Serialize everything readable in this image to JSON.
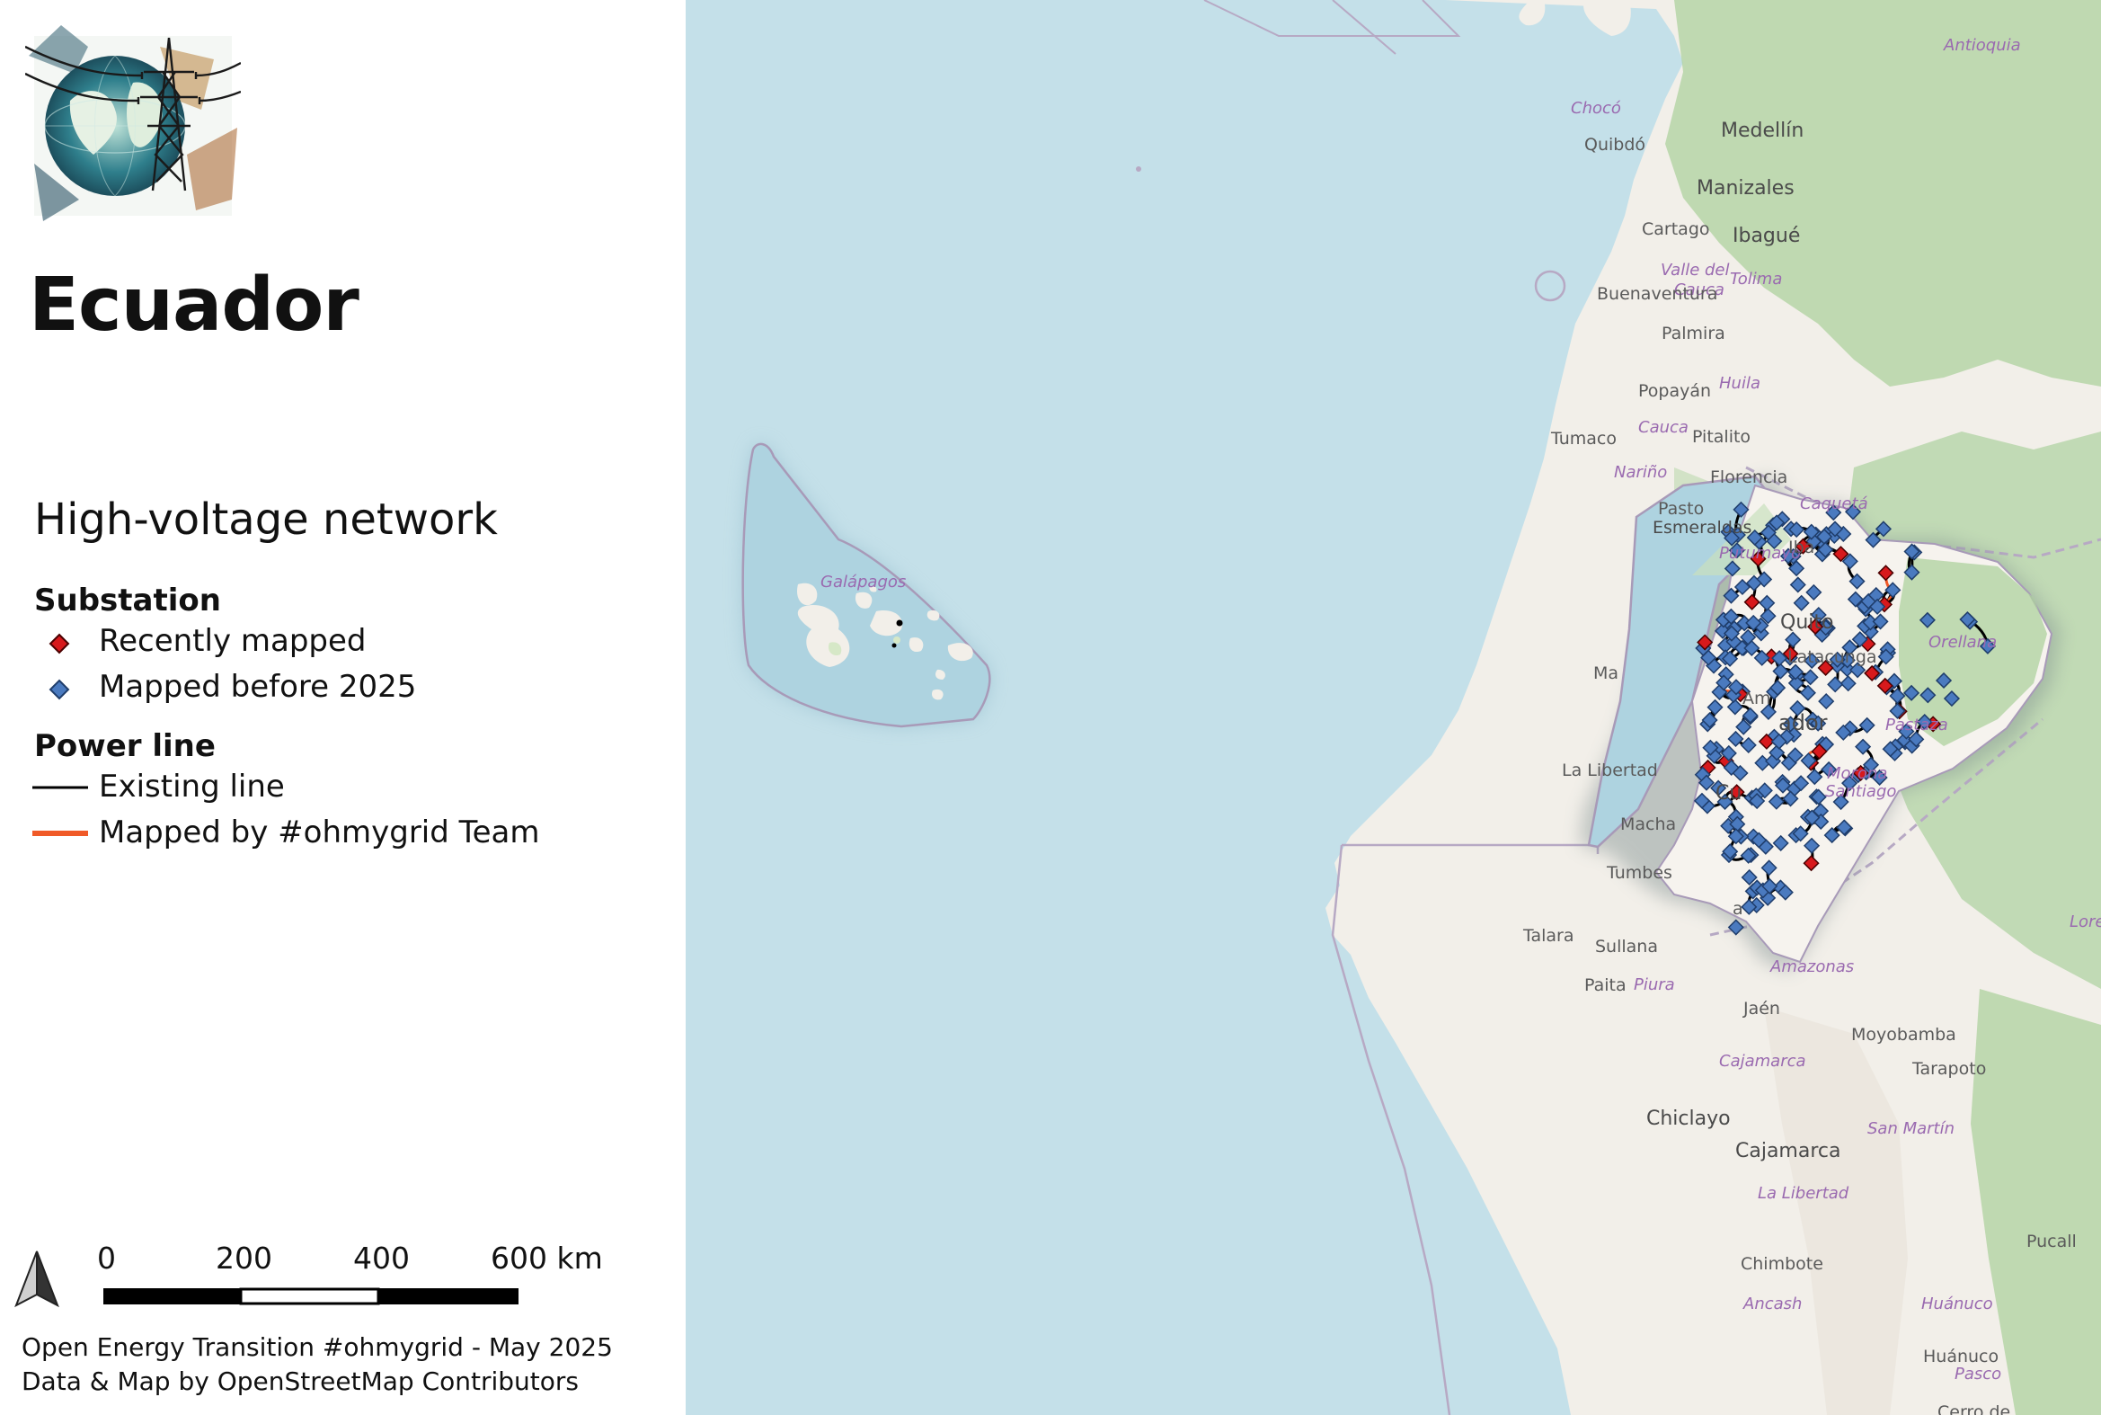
{
  "title": "Ecuador",
  "legend": {
    "title": "High-voltage network",
    "substation_heading": "Substation",
    "substation_items": [
      {
        "label": "Recently mapped",
        "color": "#d7191c",
        "icon": "red-diamond-marker"
      },
      {
        "label": "Mapped before 2025",
        "color": "#4a7abf",
        "icon": "blue-diamond-marker"
      }
    ],
    "powerline_heading": "Power line",
    "powerline_items": [
      {
        "label": "Existing line",
        "color": "#000000",
        "icon": "black-line-swatch"
      },
      {
        "label": "Mapped by #ohmygrid Team",
        "color": "#f05a28",
        "icon": "orange-line-swatch"
      }
    ]
  },
  "scale_bar": {
    "labels": [
      "0",
      "200",
      "400",
      "600 km"
    ]
  },
  "credits": {
    "line1": "Open Energy Transition #ohmygrid - May 2025",
    "line2": "Data & Map by OpenStreetMap Contributors"
  },
  "map_places": {
    "antioquia": "Antioquia",
    "choco": "Chocó",
    "quibdo": "Quibdó",
    "medellin": "Medellín",
    "manizales": "Manizales",
    "cartago": "Cartago",
    "ibague": "Ibagué",
    "valle_del": "Valle del",
    "cauca_region": "Cauca",
    "tolima": "Tolima",
    "buenaventura": "Buenaventura",
    "palmira": "Palmira",
    "huila": "Huila",
    "popayan": "Popayán",
    "cauca": "Cauca",
    "pitalito": "Pitalito",
    "tumaco": "Tumaco",
    "narino": "Nariño",
    "florencia": "Florencia",
    "caqueta": "Caquetá",
    "pasto": "Pasto",
    "putumayo": "Putumayo",
    "galapagos": "Galápagos",
    "esmeraldas": "Esmeraldas",
    "ibarra": "Iba",
    "quito": "Quito",
    "latacunga": "Latacunga",
    "orellana": "Orellana",
    "manta": "Ma",
    "ecuador": "ador",
    "pastaza": "Pastaza",
    "la_libertad": "La Libertad",
    "ambato": "Am",
    "cuenca": "Cu",
    "morona1": "Morona",
    "morona2": "Santiago",
    "machala": "Macha",
    "tumbes": "Tumbes",
    "talara": "Talara",
    "sullana": "Sullana",
    "loja": "a",
    "amazonas": "Amazonas",
    "paita": "Paita",
    "piura": "Piura",
    "jaen": "Jaén",
    "moyobamba": "Moyobamba",
    "tarapoto": "Tarapoto",
    "cajamarca_region": "Cajamarca",
    "san_martin": "San Martín",
    "chiclayo": "Chiclayo",
    "cajamarca": "Cajamarca",
    "la_libertad_peru": "La Libertad",
    "chimbote": "Chimbote",
    "ancash": "Ancash",
    "huanuco_region": "Huánuco",
    "huanuco": "Huánuco",
    "pasco": "Pasco",
    "pucallpa": "Pucall",
    "cerro": "Cerro de",
    "lore": "Lore"
  },
  "colors": {
    "sea": "#c4e0e9",
    "land": "#f2efe9",
    "forest": "#add19e",
    "ecuador_fill": "#f6f3ee",
    "substation_red": "#d7191c",
    "substation_blue": "#4a7abf",
    "line_black": "#000000",
    "line_orange": "#f05a28"
  }
}
